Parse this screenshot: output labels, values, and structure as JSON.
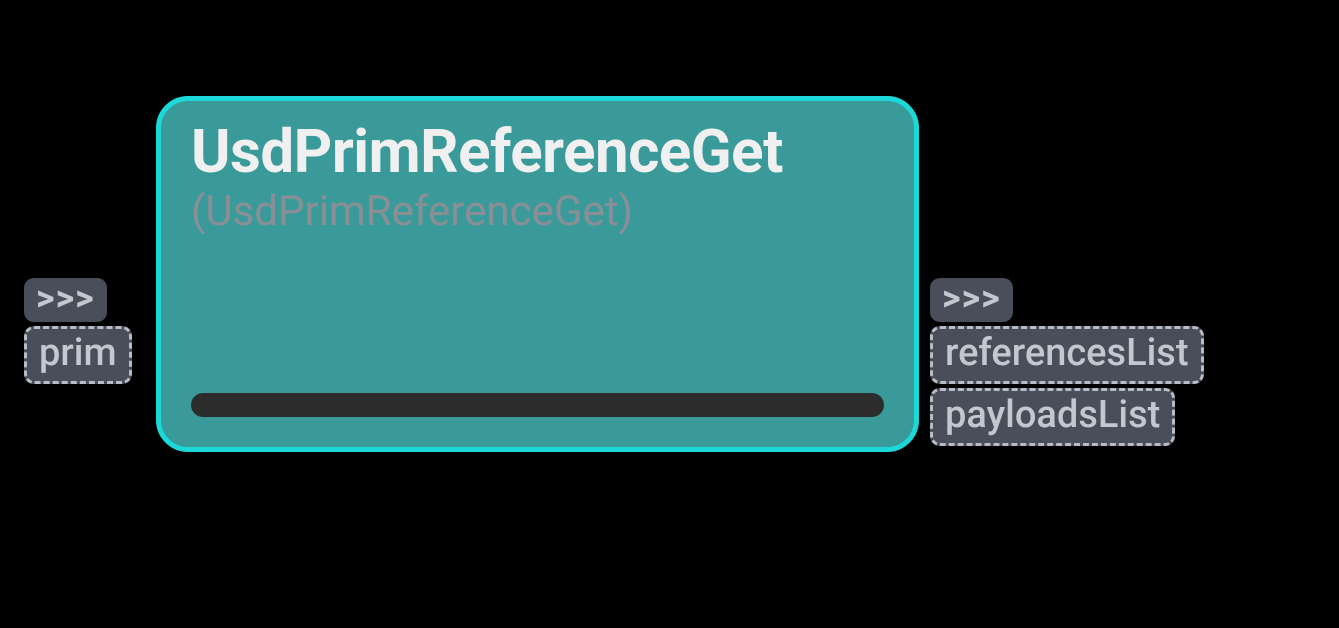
{
  "node": {
    "title": "UsdPrimReferenceGet",
    "subtitle": "(UsdPrimReferenceGet)"
  },
  "inputs": {
    "exec_symbol": ">>>",
    "ports": [
      {
        "label": "prim"
      }
    ]
  },
  "outputs": {
    "exec_symbol": ">>>",
    "ports": [
      {
        "label": "referencesList"
      },
      {
        "label": "payloadsList"
      }
    ]
  }
}
